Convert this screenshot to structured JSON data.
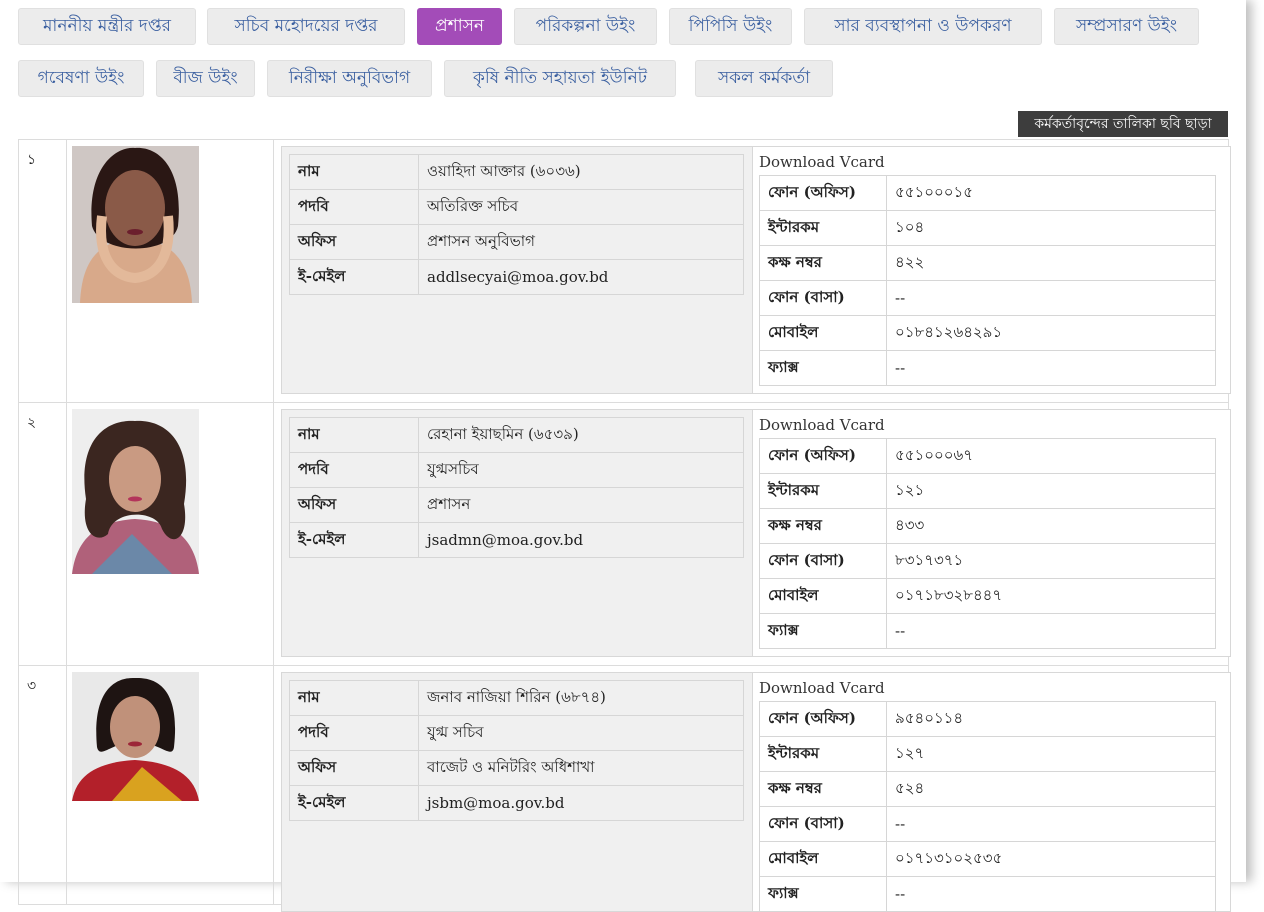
{
  "tabs_row1": [
    "মাননীয় মন্ত্রীর দপ্তর",
    "সচিব মহোদয়ের দপ্তর",
    "প্রশাসন",
    "পরিকল্পনা উইং",
    "পিপিসি উইং",
    "সার ব্যবস্থাপনা ও উপকরণ",
    "সম্প্রসারণ উইং"
  ],
  "tabs_row2": [
    "গবেষণা উইং",
    "বীজ উইং",
    "নিরীক্ষা অনুবিভাগ",
    "কৃষি নীতি সহায়তা ইউনিট",
    "সকল কর্মকর্তা"
  ],
  "active_tab": "প্রশাসন",
  "list_without_photo": "কর্মকর্তাবৃন্দের তালিকা ছবি ছাড়া",
  "labels": {
    "name": "নাম",
    "designation": "পদবি",
    "office": "অফিস",
    "email": "ই-মেইল",
    "download_vcard": "Download Vcard",
    "phone_office": "ফোন (অফিস)",
    "intercom": "ইন্টারকম",
    "room": "কক্ষ নম্বর",
    "phone_home": "ফোন (বাসা)",
    "mobile": "মোবাইল",
    "fax": "ফ্যাক্স"
  },
  "officers": [
    {
      "serial": "১",
      "name": "ওয়াহিদা আক্তার (৬০৩৬)",
      "designation": "অতিরিক্ত সচিব",
      "office": "প্রশাসন অনুবিভাগ",
      "email": "addlsecyai@moa.gov.bd",
      "phone_office": "৫৫১০০০১৫",
      "intercom": "১০৪",
      "room": "৪২২",
      "phone_home": "--",
      "mobile": "০১৮৪১২৬৪২৯১",
      "fax": "--"
    },
    {
      "serial": "২",
      "name": "রেহানা ইয়াছমিন (৬৫৩৯)",
      "designation": "যুগ্মসচিব",
      "office": "প্রশাসন",
      "email": "jsadmn@moa.gov.bd",
      "phone_office": "৫৫১০০০৬৭",
      "intercom": "১২১",
      "room": "৪৩৩",
      "phone_home": "৮৩১৭৩৭১",
      "mobile": "০১৭১৮৩২৮৪৪৭",
      "fax": "--"
    },
    {
      "serial": "৩",
      "name": "জনাব নাজিয়া শিরিন (৬৮৭৪)",
      "designation": "যুগ্ম সচিব",
      "office": "বাজেট ও মনিটরিং অধিশাখা",
      "email": "jsbm@moa.gov.bd",
      "phone_office": "৯৫৪০১১৪",
      "intercom": "১২৭",
      "room": "৫২৪",
      "phone_home": "--",
      "mobile": "০১৭১৩১০২৫৩৫",
      "fax": "--"
    }
  ]
}
